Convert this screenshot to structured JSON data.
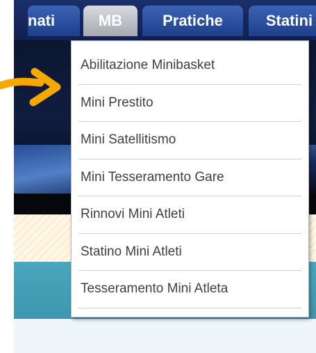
{
  "nav": {
    "tabs": [
      {
        "label": "nati"
      },
      {
        "label": "MB"
      },
      {
        "label": "Pratiche"
      },
      {
        "label": "Statini"
      }
    ]
  },
  "dropdown": {
    "items": [
      {
        "label": "Abilitazione Minibasket"
      },
      {
        "label": "Mini Prestito"
      },
      {
        "label": "Mini Satellitismo"
      },
      {
        "label": "Mini Tesseramento Gare"
      },
      {
        "label": "Rinnovi Mini Atleti"
      },
      {
        "label": "Statino Mini Atleti"
      },
      {
        "label": "Tesseramento Mini Atleta"
      }
    ]
  },
  "colors": {
    "nav_bg": "#1b2f6a",
    "tab_blue": "#2a4f9e",
    "tab_active": "#b8bbc2",
    "arrow": "#f5a800",
    "teal": "#49a6bd"
  },
  "icons": {
    "pointer": "arrow-right-icon"
  }
}
